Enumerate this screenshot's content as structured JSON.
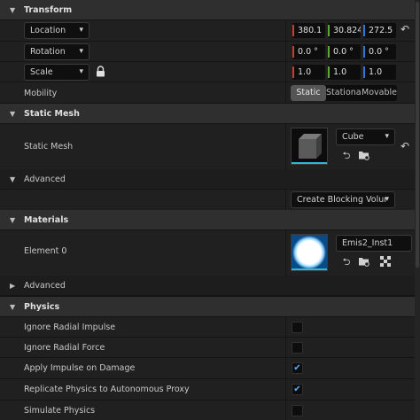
{
  "transform": {
    "header": "Transform",
    "location": {
      "label": "Location",
      "x": "380.1",
      "y": "30.824",
      "z": "272.5"
    },
    "rotation": {
      "label": "Rotation",
      "x": "0.0 °",
      "y": "0.0 °",
      "z": "0.0 °"
    },
    "scale": {
      "label": "Scale",
      "x": "1.0",
      "y": "1.0",
      "z": "1.0"
    },
    "mobility": {
      "label": "Mobility",
      "options": [
        "Static",
        "Stationary",
        "Movable"
      ],
      "selected": "Static"
    }
  },
  "static_mesh": {
    "header": "Static Mesh",
    "label": "Static Mesh",
    "asset": "Cube",
    "thumb_bar_color": "#2fb7d8"
  },
  "advanced_1": {
    "label": "Advanced",
    "button": "Create Blocking Volume"
  },
  "materials": {
    "header": "Materials",
    "element_label": "Element 0",
    "asset": "Emis2_Inst1",
    "thumb_bar_color": "#2fb7d8"
  },
  "advanced_2": {
    "label": "Advanced"
  },
  "physics": {
    "header": "Physics",
    "rows": [
      {
        "label": "Ignore Radial Impulse",
        "checked": false
      },
      {
        "label": "Ignore Radial Force",
        "checked": false
      },
      {
        "label": "Apply Impulse on Damage",
        "checked": true
      },
      {
        "label": "Replicate Physics to Autonomous Proxy",
        "checked": true
      },
      {
        "label": "Simulate Physics",
        "checked": false
      }
    ]
  },
  "icons": {
    "collapse": "triangle-down",
    "expand": "triangle-right",
    "reset": "reset-arrow",
    "lock": "lock",
    "browse": "browse-arrow",
    "folder": "folder-search"
  }
}
